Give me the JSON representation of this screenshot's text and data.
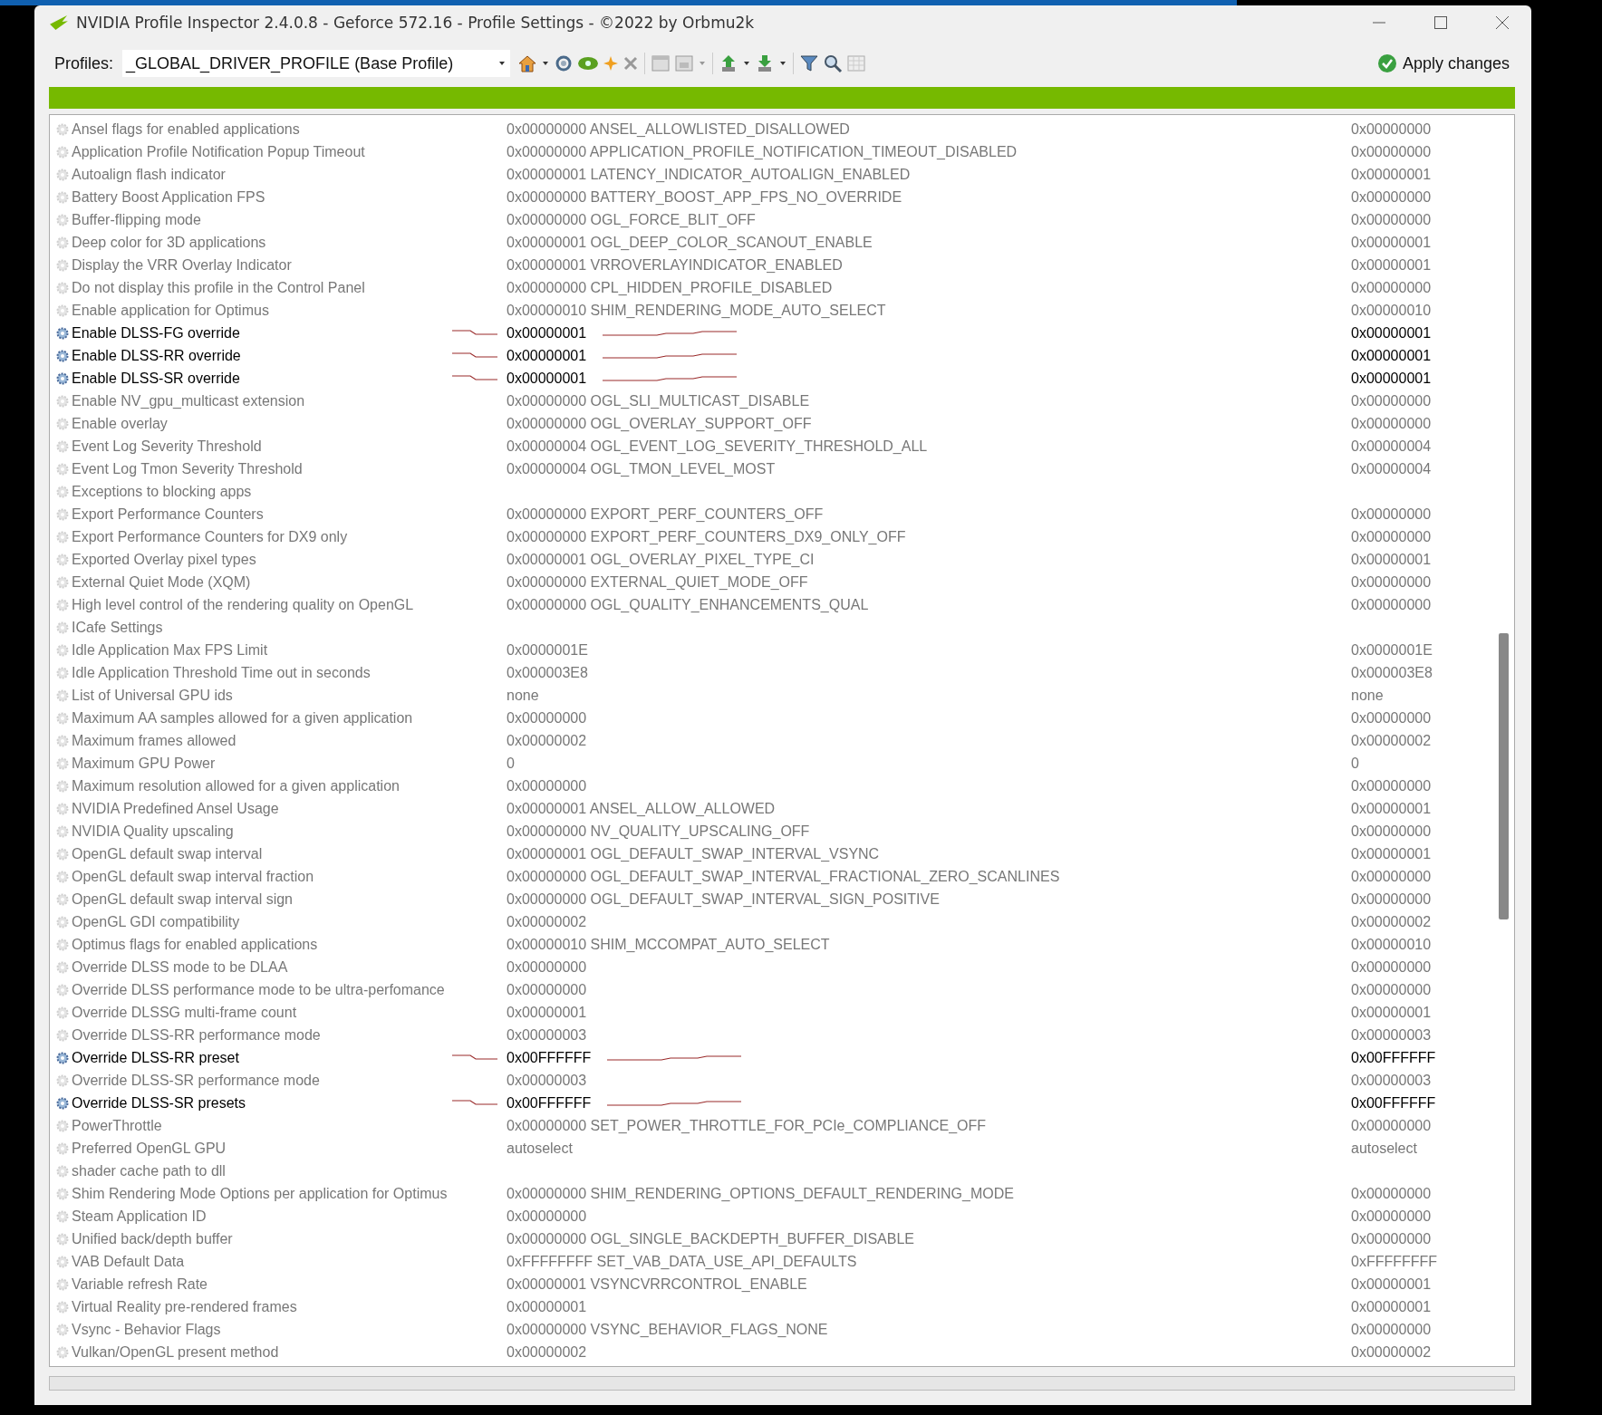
{
  "window": {
    "title": "NVIDIA Profile Inspector 2.4.0.8 - Geforce 572.16 - Profile Settings - ©2022 by Orbmu2k"
  },
  "toolbar": {
    "profiles_label": "Profiles:",
    "profile": "_GLOBAL_DRIVER_PROFILE (Base Profile)",
    "apply_button": "Apply changes"
  },
  "settings": [
    {
      "name": "Ansel flags for enabled applications",
      "value": "0x00000000 ANSEL_ALLOWLISTED_DISALLOWED",
      "default": "0x00000000",
      "modified": false
    },
    {
      "name": "Application Profile Notification Popup Timeout",
      "value": "0x00000000 APPLICATION_PROFILE_NOTIFICATION_TIMEOUT_DISABLED",
      "default": "0x00000000",
      "modified": false
    },
    {
      "name": "Autoalign flash indicator",
      "value": "0x00000001 LATENCY_INDICATOR_AUTOALIGN_ENABLED",
      "default": "0x00000001",
      "modified": false
    },
    {
      "name": "Battery Boost Application FPS",
      "value": "0x00000000 BATTERY_BOOST_APP_FPS_NO_OVERRIDE",
      "default": "0x00000000",
      "modified": false
    },
    {
      "name": "Buffer-flipping mode",
      "value": "0x00000000 OGL_FORCE_BLIT_OFF",
      "default": "0x00000000",
      "modified": false
    },
    {
      "name": "Deep color for 3D applications",
      "value": "0x00000001 OGL_DEEP_COLOR_SCANOUT_ENABLE",
      "default": "0x00000001",
      "modified": false
    },
    {
      "name": "Display the VRR Overlay Indicator",
      "value": "0x00000001 VRROVERLAYINDICATOR_ENABLED",
      "default": "0x00000001",
      "modified": false
    },
    {
      "name": "Do not display this profile in the Control Panel",
      "value": "0x00000000 CPL_HIDDEN_PROFILE_DISABLED",
      "default": "0x00000000",
      "modified": false
    },
    {
      "name": "Enable application for Optimus",
      "value": "0x00000010 SHIM_RENDERING_MODE_AUTO_SELECT",
      "default": "0x00000010",
      "modified": false
    },
    {
      "name": "Enable DLSS-FG override",
      "value": "0x00000001",
      "default": "0x00000001",
      "modified": true
    },
    {
      "name": "Enable DLSS-RR override",
      "value": "0x00000001",
      "default": "0x00000001",
      "modified": true
    },
    {
      "name": "Enable DLSS-SR override",
      "value": "0x00000001",
      "default": "0x00000001",
      "modified": true
    },
    {
      "name": "Enable NV_gpu_multicast extension",
      "value": "0x00000000 OGL_SLI_MULTICAST_DISABLE",
      "default": "0x00000000",
      "modified": false
    },
    {
      "name": "Enable overlay",
      "value": "0x00000000 OGL_OVERLAY_SUPPORT_OFF",
      "default": "0x00000000",
      "modified": false
    },
    {
      "name": "Event Log Severity Threshold",
      "value": "0x00000004 OGL_EVENT_LOG_SEVERITY_THRESHOLD_ALL",
      "default": "0x00000004",
      "modified": false
    },
    {
      "name": "Event Log Tmon Severity Threshold",
      "value": "0x00000004 OGL_TMON_LEVEL_MOST",
      "default": "0x00000004",
      "modified": false
    },
    {
      "name": "Exceptions to blocking apps",
      "modified": false
    },
    {
      "name": "Export Performance Counters",
      "value": "0x00000000 EXPORT_PERF_COUNTERS_OFF",
      "default": "0x00000000",
      "modified": false
    },
    {
      "name": "Export Performance Counters for DX9 only",
      "value": "0x00000000 EXPORT_PERF_COUNTERS_DX9_ONLY_OFF",
      "default": "0x00000000",
      "modified": false
    },
    {
      "name": "Exported Overlay pixel types",
      "value": "0x00000001 OGL_OVERLAY_PIXEL_TYPE_CI",
      "default": "0x00000001",
      "modified": false
    },
    {
      "name": "External Quiet Mode (XQM)",
      "value": "0x00000000 EXTERNAL_QUIET_MODE_OFF",
      "default": "0x00000000",
      "modified": false
    },
    {
      "name": "High level control of the rendering quality on OpenGL",
      "value": "0x00000000 OGL_QUALITY_ENHANCEMENTS_QUAL",
      "default": "0x00000000",
      "modified": false
    },
    {
      "name": "ICafe Settings",
      "modified": false
    },
    {
      "name": "Idle Application Max FPS Limit",
      "value": "0x0000001E",
      "default": "0x0000001E",
      "modified": false
    },
    {
      "name": "Idle Application Threshold Time out in seconds",
      "value": "0x000003E8",
      "default": "0x000003E8",
      "modified": false
    },
    {
      "name": "List of Universal GPU ids",
      "value": "none",
      "default": "none",
      "modified": false
    },
    {
      "name": "Maximum AA samples allowed for a given application",
      "value": "0x00000000",
      "default": "0x00000000",
      "modified": false
    },
    {
      "name": "Maximum frames allowed",
      "value": "0x00000002",
      "default": "0x00000002",
      "modified": false
    },
    {
      "name": "Maximum GPU Power",
      "value": "0",
      "default": "0",
      "modified": false
    },
    {
      "name": "Maximum resolution allowed for a given application",
      "value": "0x00000000",
      "default": "0x00000000",
      "modified": false
    },
    {
      "name": "NVIDIA Predefined Ansel Usage",
      "value": "0x00000001 ANSEL_ALLOW_ALLOWED",
      "default": "0x00000001",
      "modified": false
    },
    {
      "name": "NVIDIA Quality upscaling",
      "value": "0x00000000 NV_QUALITY_UPSCALING_OFF",
      "default": "0x00000000",
      "modified": false
    },
    {
      "name": "OpenGL default swap interval",
      "value": "0x00000001 OGL_DEFAULT_SWAP_INTERVAL_VSYNC",
      "default": "0x00000001",
      "modified": false
    },
    {
      "name": "OpenGL default swap interval fraction",
      "value": "0x00000000 OGL_DEFAULT_SWAP_INTERVAL_FRACTIONAL_ZERO_SCANLINES",
      "default": "0x00000000",
      "modified": false
    },
    {
      "name": "OpenGL default swap interval sign",
      "value": "0x00000000 OGL_DEFAULT_SWAP_INTERVAL_SIGN_POSITIVE",
      "default": "0x00000000",
      "modified": false
    },
    {
      "name": "OpenGL GDI compatibility",
      "value": "0x00000002",
      "default": "0x00000002",
      "modified": false
    },
    {
      "name": "Optimus flags for enabled applications",
      "value": "0x00000010 SHIM_MCCOMPAT_AUTO_SELECT",
      "default": "0x00000010",
      "modified": false
    },
    {
      "name": "Override DLSS mode to be DLAA",
      "value": "0x00000000",
      "default": "0x00000000",
      "modified": false
    },
    {
      "name": "Override DLSS performance mode to be ultra-perfomance",
      "value": "0x00000000",
      "default": "0x00000000",
      "modified": false
    },
    {
      "name": "Override DLSSG multi-frame count",
      "value": "0x00000001",
      "default": "0x00000001",
      "modified": false
    },
    {
      "name": "Override DLSS-RR performance mode",
      "value": "0x00000003",
      "default": "0x00000003",
      "modified": false
    },
    {
      "name": "Override DLSS-RR preset",
      "value": "0x00FFFFFF",
      "default": "0x00FFFFFF",
      "modified": true
    },
    {
      "name": "Override DLSS-SR performance mode",
      "value": "0x00000003",
      "default": "0x00000003",
      "modified": false
    },
    {
      "name": "Override DLSS-SR presets",
      "value": "0x00FFFFFF",
      "default": "0x00FFFFFF",
      "modified": true
    },
    {
      "name": "PowerThrottle",
      "value": "0x00000000 SET_POWER_THROTTLE_FOR_PCIe_COMPLIANCE_OFF",
      "default": "0x00000000",
      "modified": false
    },
    {
      "name": "Preferred OpenGL GPU",
      "value": "autoselect",
      "default": "autoselect",
      "modified": false
    },
    {
      "name": "shader cache path to dll",
      "modified": false
    },
    {
      "name": "Shim Rendering Mode Options per application for Optimus",
      "value": "0x00000000 SHIM_RENDERING_OPTIONS_DEFAULT_RENDERING_MODE",
      "default": "0x00000000",
      "modified": false
    },
    {
      "name": "Steam Application ID",
      "value": "0x00000000",
      "default": "0x00000000",
      "modified": false
    },
    {
      "name": "Unified back/depth buffer",
      "value": "0x00000000 OGL_SINGLE_BACKDEPTH_BUFFER_DISABLE",
      "default": "0x00000000",
      "modified": false
    },
    {
      "name": "VAB Default Data",
      "value": "0xFFFFFFFF SET_VAB_DATA_USE_API_DEFAULTS",
      "default": "0xFFFFFFFF",
      "modified": false
    },
    {
      "name": "Variable refresh Rate",
      "value": "0x00000001 VSYNCVRRCONTROL_ENABLE",
      "default": "0x00000001",
      "modified": false
    },
    {
      "name": "Virtual Reality pre-rendered frames",
      "value": "0x00000001",
      "default": "0x00000001",
      "modified": false
    },
    {
      "name": "Vsync - Behavior Flags",
      "value": "0x00000000 VSYNC_BEHAVIOR_FLAGS_NONE",
      "default": "0x00000000",
      "modified": false
    },
    {
      "name": "Vulkan/OpenGL present method",
      "value": "0x00000002",
      "default": "0x00000002",
      "modified": false
    }
  ]
}
